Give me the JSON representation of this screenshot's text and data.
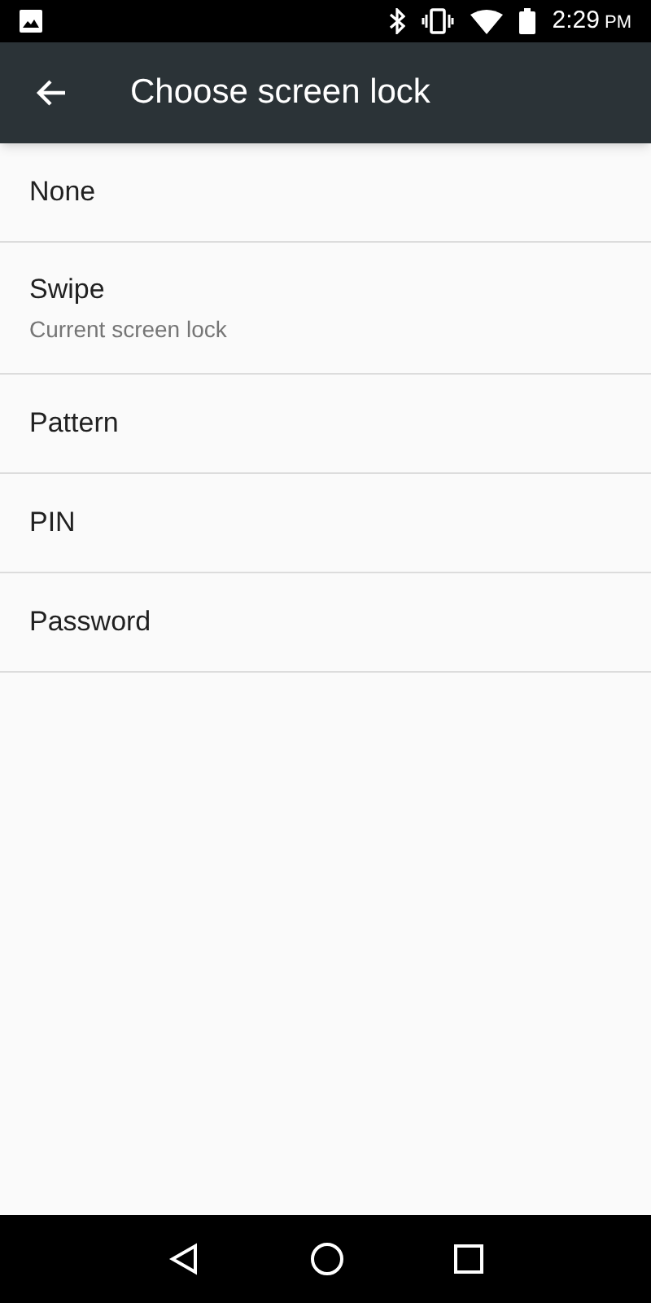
{
  "status_bar": {
    "time": "2:29",
    "ampm": "PM"
  },
  "toolbar": {
    "title": "Choose screen lock"
  },
  "options": [
    {
      "label": "None"
    },
    {
      "label": "Swipe",
      "summary": "Current screen lock"
    },
    {
      "label": "Pattern"
    },
    {
      "label": "PIN"
    },
    {
      "label": "Password"
    }
  ]
}
